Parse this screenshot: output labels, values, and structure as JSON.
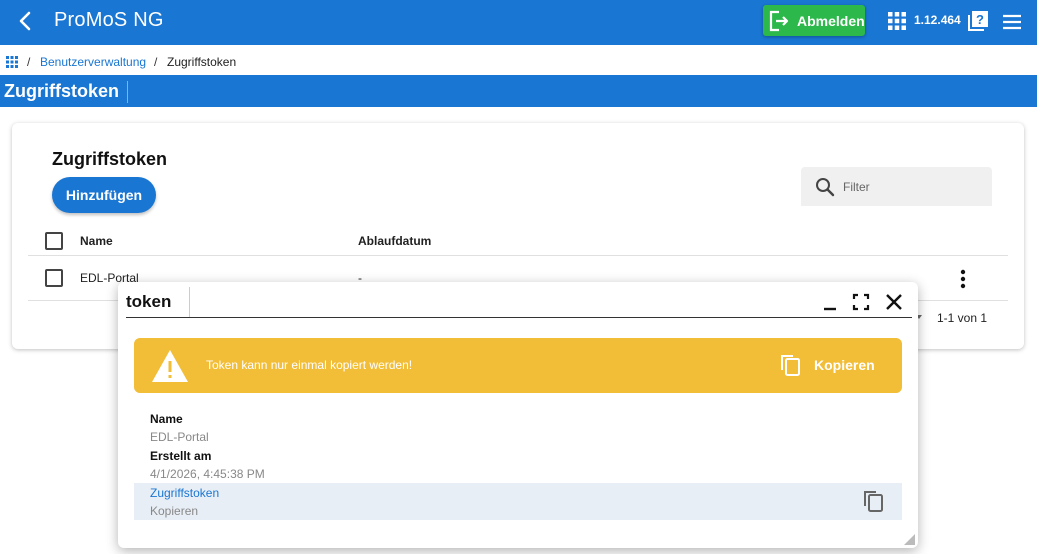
{
  "topbar": {
    "title": "ProMoS NG",
    "logout_label": "Abmelden",
    "version": "1.12.464",
    "color": "#1976d2",
    "logout_color": "#2db84b"
  },
  "breadcrumb": {
    "sep": "/",
    "link": "Benutzerverwaltung",
    "current": "Zugriffstoken"
  },
  "page": {
    "band_title": "Zugriffstoken"
  },
  "card": {
    "title": "Zugriffstoken",
    "add_label": "Hinzufügen",
    "filter_placeholder": "Filter",
    "columns": [
      "Name",
      "Ablaufdatum"
    ],
    "rows": [
      {
        "name": "EDL-Portal",
        "expiry": "-"
      }
    ],
    "pager": "1-1 von 1"
  },
  "dialog": {
    "title": "token",
    "warning_text": "Token kann nur einmal kopiert werden!",
    "warning_copy_label": "Kopieren",
    "warning_color": "#f2bd37",
    "fields": [
      {
        "label": "Name",
        "value": "EDL-Portal"
      },
      {
        "label": "Erstellt am",
        "value": "4/1/2026, 4:45:38 PM"
      }
    ],
    "token": {
      "label": "Zugriffstoken",
      "value": "Kopieren"
    }
  }
}
